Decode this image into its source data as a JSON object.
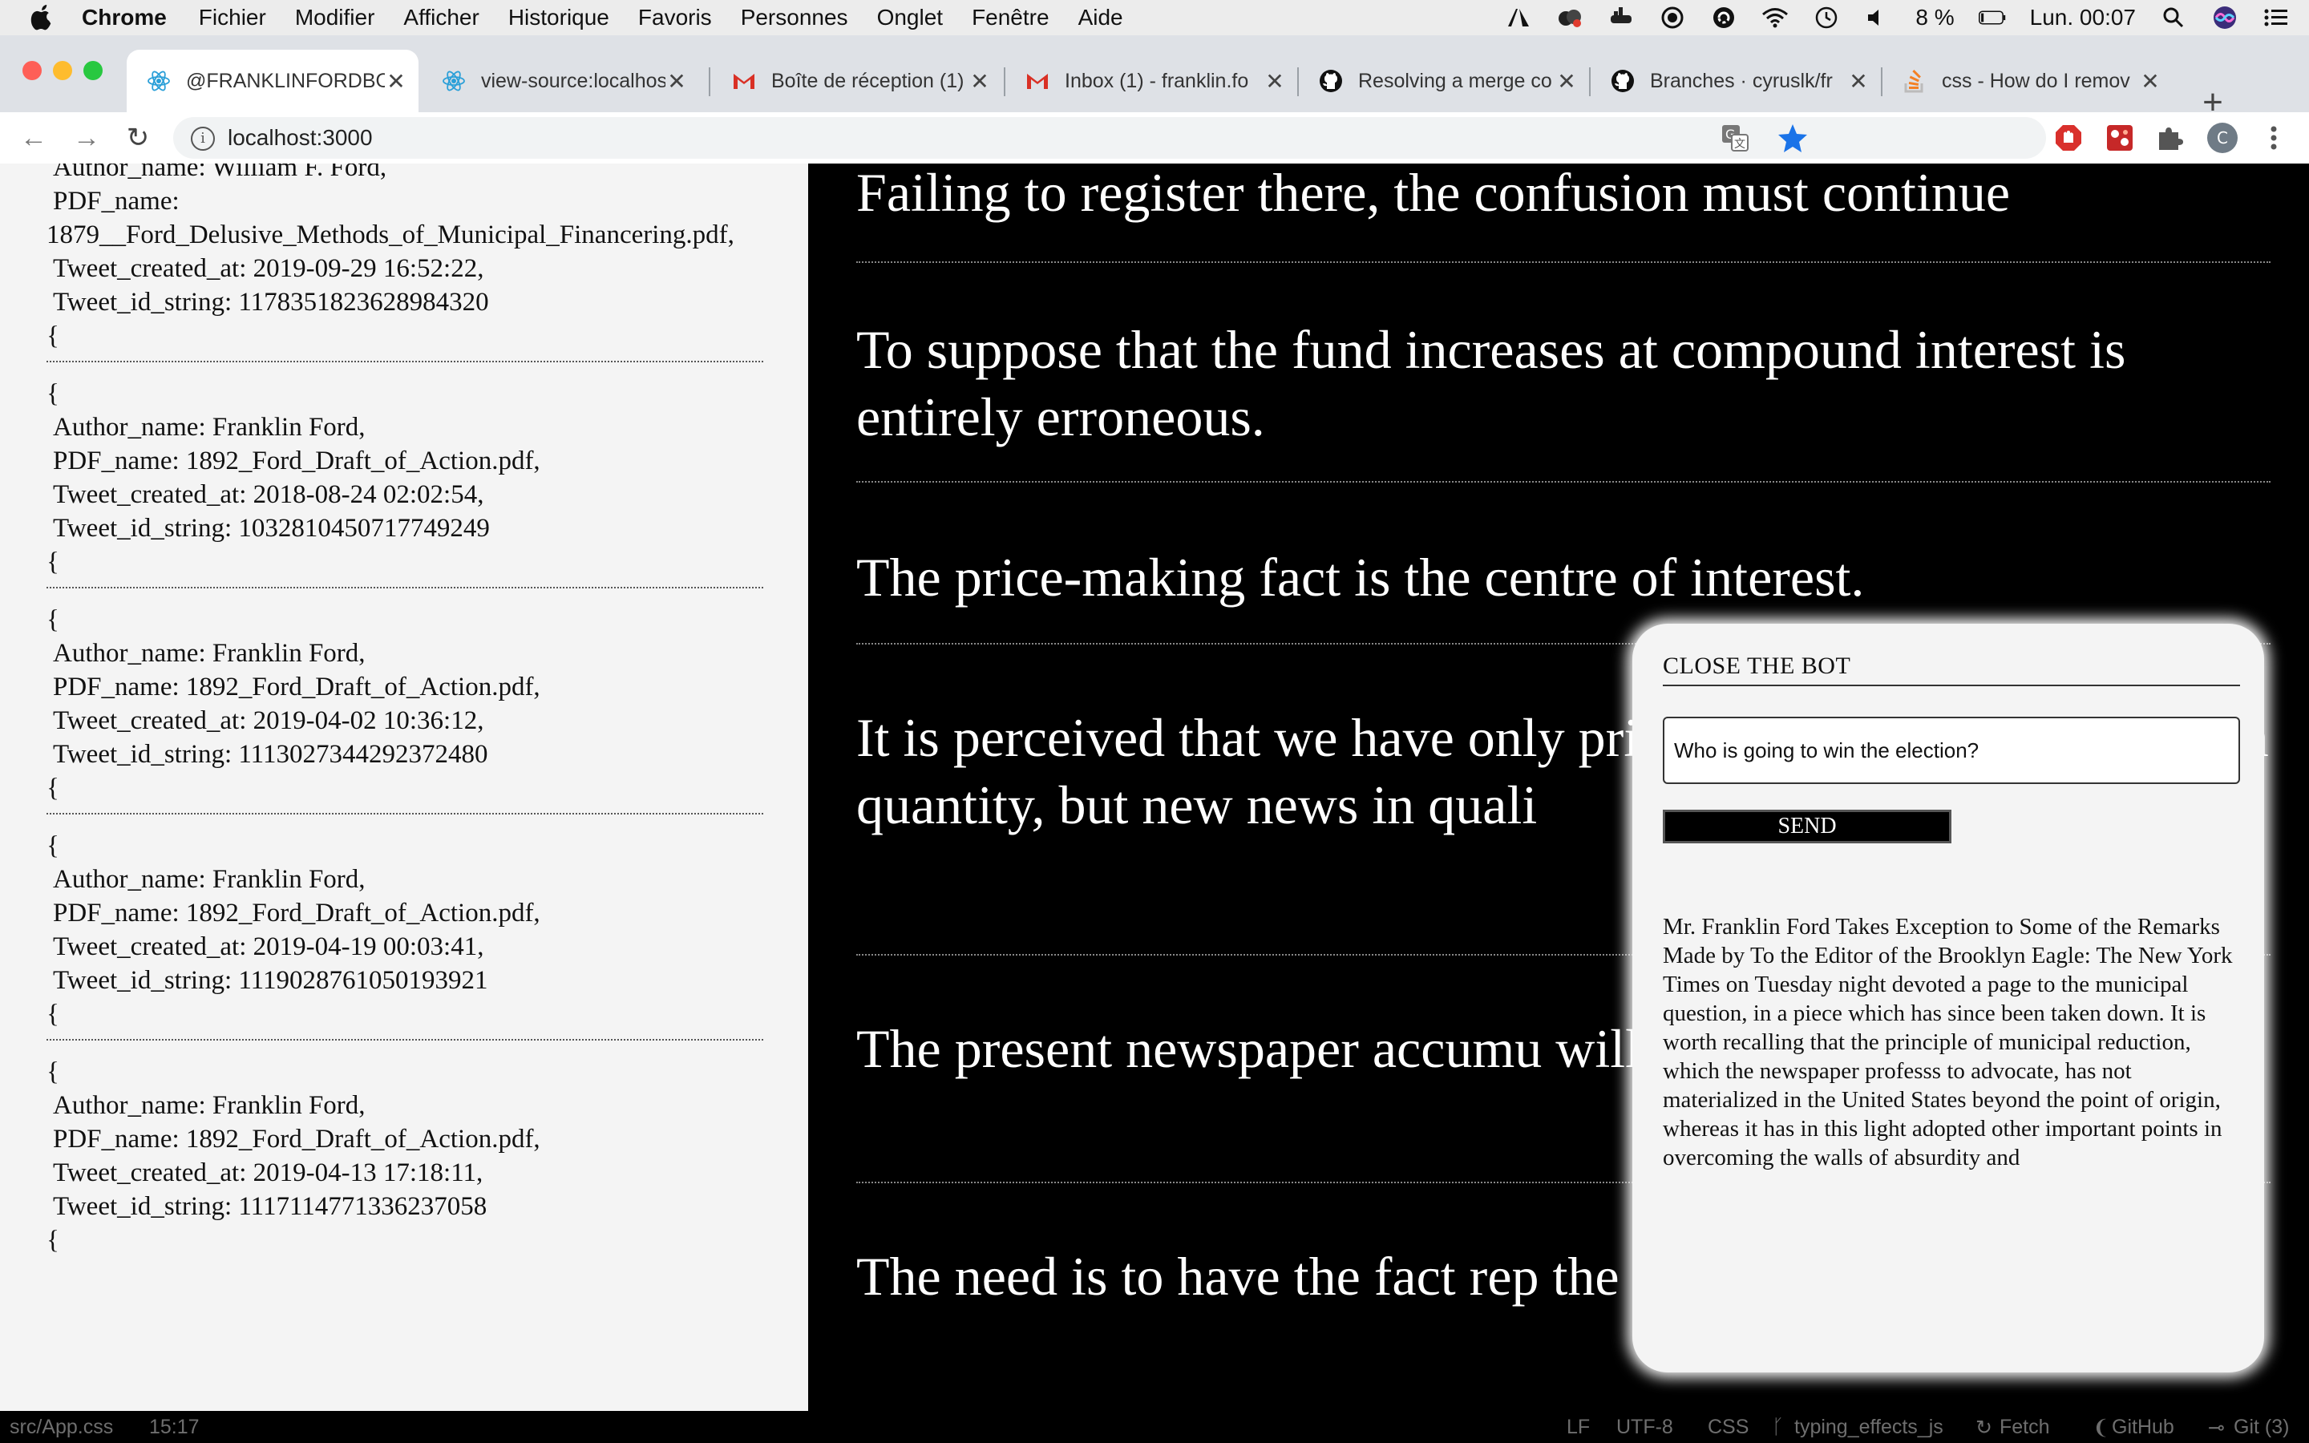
{
  "menubar": {
    "items": [
      "Chrome",
      "Fichier",
      "Modifier",
      "Afficher",
      "Historique",
      "Favoris",
      "Personnes",
      "Onglet",
      "Fenêtre",
      "Aide"
    ],
    "battery": "8 %",
    "clock": "Lun. 00:07"
  },
  "tabs": [
    {
      "title": "@FRANKLINFORDBOT",
      "icon": "react-icon",
      "active": true
    },
    {
      "title": "view-source:localhost",
      "icon": "react-icon"
    },
    {
      "title": "Boîte de réception (1)",
      "icon": "gmail-icon"
    },
    {
      "title": "Inbox (1) - franklin.fo",
      "icon": "gmail-icon"
    },
    {
      "title": "Resolving a merge co",
      "icon": "github-icon"
    },
    {
      "title": "Branches · cyruslk/fr",
      "icon": "github-icon"
    },
    {
      "title": "css - How do I remov",
      "icon": "stackoverflow-icon"
    }
  ],
  "address_bar": {
    "url": "localhost:3000"
  },
  "left_panel": {
    "records": [
      {
        "author": "Author_name: William F. Ford,",
        "pdf_label": "PDF_name:",
        "pdf": "1879__Ford_Delusive_Methods_of_Municipal_Financering.pdf,",
        "created": "Tweet_created_at: 2019-09-29 16:52:22,",
        "id": "Tweet_id_string: 1178351823628984320",
        "brace": "{"
      },
      {
        "open": "{",
        "author": "Author_name: Franklin Ford,",
        "pdf": "PDF_name: 1892_Ford_Draft_of_Action.pdf,",
        "created": "Tweet_created_at: 2018-08-24 02:02:54,",
        "id": "Tweet_id_string: 1032810450717749249",
        "brace": "{"
      },
      {
        "open": "{",
        "author": "Author_name: Franklin Ford,",
        "pdf": "PDF_name: 1892_Ford_Draft_of_Action.pdf,",
        "created": "Tweet_created_at: 2019-04-02 10:36:12,",
        "id": "Tweet_id_string: 1113027344292372480",
        "brace": "{"
      },
      {
        "open": "{",
        "author": "Author_name: Franklin Ford,",
        "pdf": "PDF_name: 1892_Ford_Draft_of_Action.pdf,",
        "created": "Tweet_created_at: 2019-04-19 00:03:41,",
        "id": "Tweet_id_string: 1119028761050193921",
        "brace": "{"
      },
      {
        "open": "{",
        "author": "Author_name: Franklin Ford,",
        "pdf": "PDF_name: 1892_Ford_Draft_of_Action.pdf,",
        "created": "Tweet_created_at: 2019-04-13 17:18:11,",
        "id": "Tweet_id_string: 1117114771336237058",
        "brace": "{"
      }
    ]
  },
  "quotes": [
    "Failing to register there, the confusion must continue",
    "To suppose that the fund increases at compound interest is entirely erroneous.",
    "The price-making fact is the centre of interest.",
    "It is perceived that we have only principle in order to get not sim quantity, but new news in quali",
    "The present newspaper accumu will record history.",
    "The need is to have the fact rep the whole"
  ],
  "bot": {
    "close_label": "CLOSE THE BOT",
    "input_value": "Who is going to win the election?",
    "send_label": "SEND",
    "answer": "Mr. Franklin Ford Takes Exception to Some of the Remarks Made by To the Editor of the Brooklyn Eagle: The New York Times on Tuesday night devoted a page to the municipal question, in a piece which has since been taken down. It is worth recalling that the principle of municipal reduction, which the newspaper professs to advocate, has not materialized in the United States beyond the point of origin, whereas it has in this light adopted other important points in overcoming the walls of absurdity and"
  },
  "statusbar": {
    "file": "src/App.css",
    "position": "15:17",
    "eol": "LF",
    "encoding": "UTF-8",
    "language": "CSS",
    "branch": "typing_effects_js",
    "fetch": "Fetch",
    "github": "GitHub",
    "git": "Git (3)"
  },
  "colors": {
    "accent": "#1a73e8",
    "tab_bar": "#dee1e6",
    "panel": "#f4f4f4"
  }
}
